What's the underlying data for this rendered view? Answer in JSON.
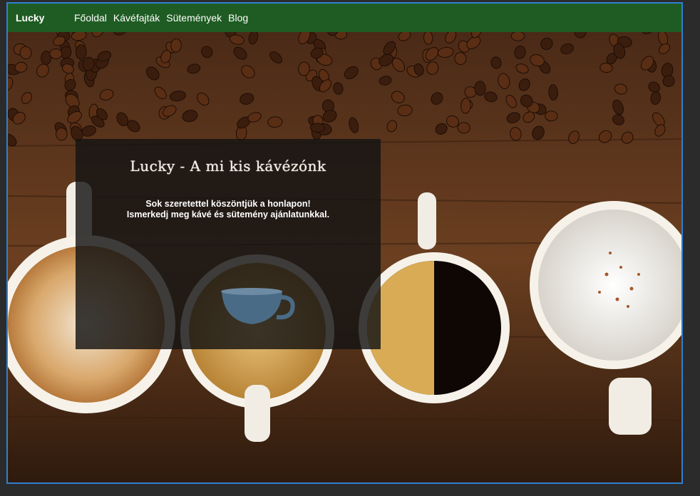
{
  "nav": {
    "brand": "Lucky",
    "links": [
      "Főoldal",
      "Kávéfajták",
      "Sütemények",
      "Blog"
    ]
  },
  "hero": {
    "title": "Lucky - A mi kis kávézónk",
    "line1": "Sok szeretettel köszöntjük a honlapon!",
    "line2": "Ismerkedj meg kávé és sütemény ajánlatunkkal."
  },
  "colors": {
    "navbar": "#1f5c23",
    "frame_border": "#2f80d1",
    "overlay": "#141414"
  },
  "icons": [
    "coffee-cup-icon"
  ]
}
